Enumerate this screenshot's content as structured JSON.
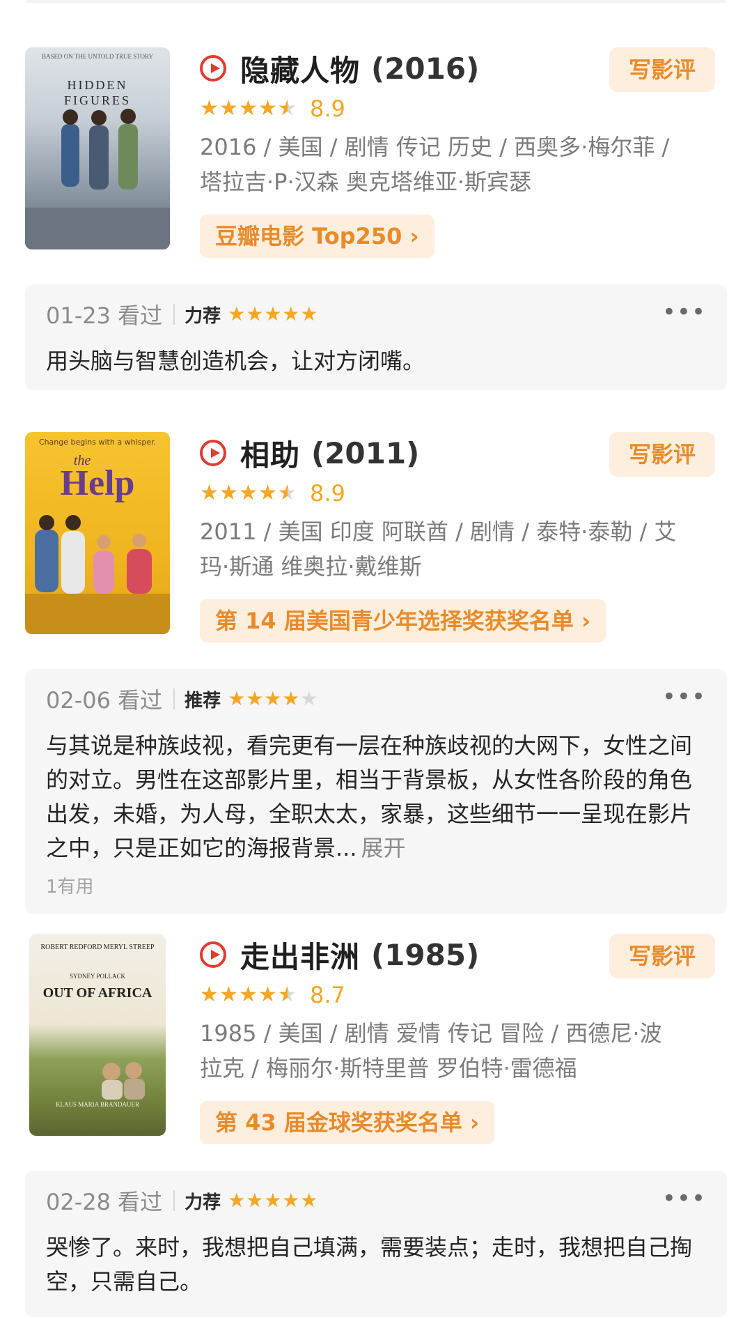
{
  "movies": [
    {
      "title": "隐藏人物",
      "year": "(2016)",
      "rating": "8.9",
      "stars_fraction": 0.9,
      "meta_line1": "2016 / 美国 / 剧情 传记 历史 / 西奥多·梅尔菲 /",
      "meta_line2": "塔拉吉·P·汉森 奥克塔维亚·斯宾瑟",
      "tag": "豆瓣电影 Top250 ›",
      "write_label": "写影评",
      "poster": {
        "line1": "HIDDEN",
        "line2": "FIGURES",
        "top_note": "BASED ON THE UNTOLD TRUE STORY"
      },
      "review": {
        "date": "01-23 看过",
        "level": "力荐",
        "stars": 5,
        "text": "用头脑与智慧创造机会，让对方闭嘴。",
        "expand": "",
        "helpful": ""
      }
    },
    {
      "title": "相助",
      "year": "(2011)",
      "rating": "8.9",
      "stars_fraction": 0.9,
      "meta_line1": "2011 / 美国 印度 阿联酋 / 剧情 / 泰特·泰勒 / 艾",
      "meta_line2": "玛·斯通 维奥拉·戴维斯",
      "tag": "第 14 届美国青少年选择奖获奖名单 ›",
      "write_label": "写影评",
      "poster": {
        "line1": "the",
        "line2": "Help",
        "top_note": "Change begins with a whisper."
      },
      "review": {
        "date": "02-06 看过",
        "level": "推荐",
        "stars": 4,
        "text": "与其说是种族歧视，看完更有一层在种族歧视的大网下，女性之间的对立。男性在这部影片里，相当于背景板，从女性各阶段的角色出发，未婚，为人母，全职太太，家暴，这些细节一一呈现在影片之中，只是正如它的海报背景...",
        "expand": "展开",
        "helpful": "1有用"
      }
    },
    {
      "title": "走出非洲",
      "year": "(1985)",
      "rating": "8.7",
      "stars_fraction": 0.9,
      "meta_line1": "1985 / 美国 / 剧情 爱情 传记 冒险 / 西德尼·波",
      "meta_line2": "拉克 / 梅丽尔·斯特里普 罗伯特·雷德福",
      "tag": "第 43 届金球奖获奖名单 ›",
      "write_label": "写影评",
      "poster": {
        "line1": "ROBERT REDFORD   MERYL STREEP",
        "line2": "OUT OF AFRICA",
        "top_note": "SYDNEY POLLACK",
        "bottom_note": "KLAUS MARIA BRANDAUER"
      },
      "review": {
        "date": "02-28 看过",
        "level": "力荐",
        "stars": 5,
        "text": "哭惨了。来时，我想把自己填满，需要装点；走时，我想把自己掏空，只需自己。",
        "expand": "",
        "helpful": ""
      }
    }
  ],
  "icons": {
    "play": "play-circle-icon",
    "more": "more-dots-icon",
    "star": "star-icon"
  },
  "colors": {
    "accent": "#f5a623",
    "tag_bg": "#fdeede",
    "tag_text": "#e98b2a",
    "play": "#e23b30"
  }
}
